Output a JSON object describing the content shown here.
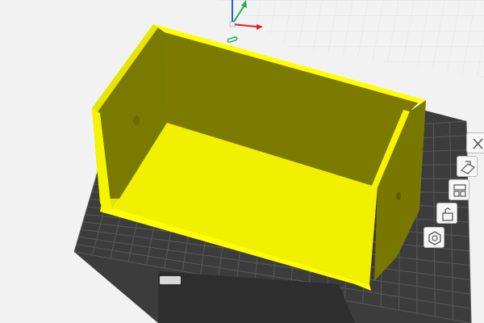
{
  "viewport": {
    "background": "#f2f2f2",
    "grid_color": "#e2e2e2",
    "bed_color": "#3e3e3e",
    "bed_grid_color": "#595959",
    "model_color": "#ffff00",
    "model_shadow_color": "#7a7a00"
  },
  "axes": {
    "x_color": "#e02020",
    "y_color": "#20b050",
    "z_color": "#2060e0"
  },
  "toolbar": {
    "tools": [
      {
        "name": "delete",
        "icon": "delete-icon"
      },
      {
        "name": "place-on-face",
        "icon": "place-on-face-icon"
      },
      {
        "name": "arrange",
        "icon": "arrange-icon"
      },
      {
        "name": "lock",
        "icon": "lock-icon"
      },
      {
        "name": "settings",
        "icon": "settings-icon"
      }
    ]
  },
  "bed": {
    "label_left": "",
    "label_right": ""
  }
}
